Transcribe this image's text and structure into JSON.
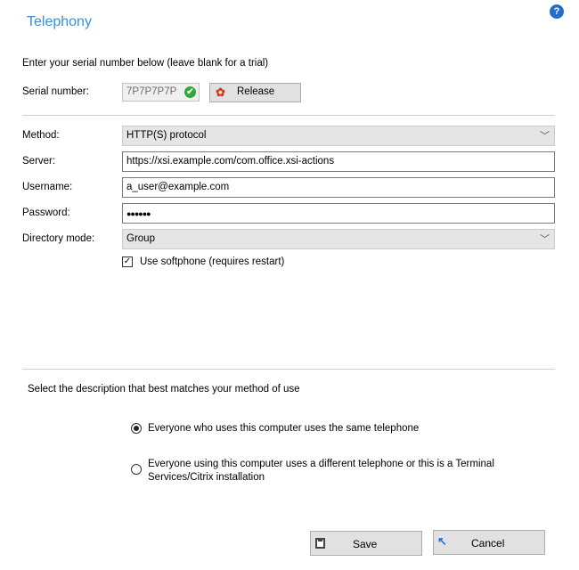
{
  "header": {
    "title": "Telephony",
    "help_icon": "?"
  },
  "serial": {
    "intro": "Enter your serial number below (leave blank for a trial)",
    "label": "Serial number:",
    "value": "7P7P7P7P",
    "valid_icon": "✔",
    "release_label": "Release"
  },
  "form": {
    "method_label": "Method:",
    "method_value": "HTTP(S) protocol",
    "server_label": "Server:",
    "server_value": "https://xsi.example.com/com.office.xsi-actions",
    "username_label": "Username:",
    "username_value": "a_user@example.com",
    "password_label": "Password:",
    "password_value": "●●●●●●",
    "directory_label": "Directory mode:",
    "directory_value": "Group",
    "chevron": "﹀",
    "softphone_label": "Use softphone (requires restart)",
    "softphone_checked": "✓"
  },
  "usage": {
    "prompt": "Select the description that best matches your method of use",
    "options": [
      {
        "label": "Everyone who uses this computer uses the same telephone",
        "selected": true
      },
      {
        "label": "Everyone using this computer uses a different telephone or this is a Terminal Services/Citrix installation",
        "selected": false
      }
    ]
  },
  "footer": {
    "save_label": "Save",
    "cancel_label": "Cancel",
    "cancel_icon": "↖"
  }
}
